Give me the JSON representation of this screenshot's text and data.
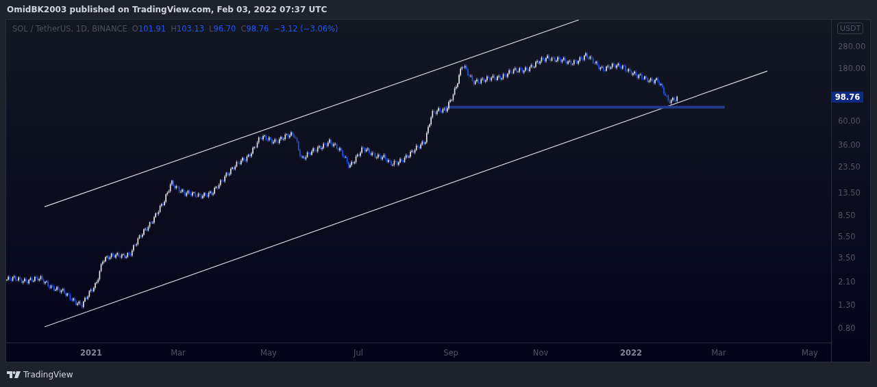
{
  "header": {
    "text": "OmidBK2003 published on TradingView.com, Feb 03, 2022 07:37 UTC"
  },
  "legend": {
    "symbol": "SOL / TetherUS, 1D, BINANCE",
    "values": [
      {
        "label": "O",
        "value": "101.91"
      },
      {
        "label": "H",
        "value": "103.13"
      },
      {
        "label": "L",
        "value": "96.70"
      },
      {
        "label": "C",
        "value": "98.76"
      }
    ],
    "change": "−3.12 (−3.06%)"
  },
  "price_axis": {
    "currency": "USDT",
    "ticks": [
      "280.00",
      "180.00",
      "60.00",
      "36.00",
      "23.50",
      "13.50",
      "8.50",
      "5.50",
      "3.50",
      "2.10",
      "1.30",
      "0.80"
    ],
    "last_price": "98.76"
  },
  "time_axis": {
    "ticks": [
      {
        "label": "2021",
        "major": true
      },
      {
        "label": "Mar",
        "major": false
      },
      {
        "label": "May",
        "major": false
      },
      {
        "label": "Jul",
        "major": false
      },
      {
        "label": "Sep",
        "major": false
      },
      {
        "label": "Nov",
        "major": false
      },
      {
        "label": "2022",
        "major": true
      },
      {
        "label": "Mar",
        "major": false
      },
      {
        "label": "May",
        "major": false
      }
    ]
  },
  "footer": {
    "brand": "TradingView"
  }
}
